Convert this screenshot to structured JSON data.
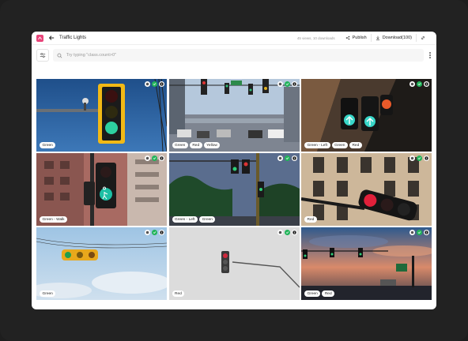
{
  "header": {
    "title": "Traffic Lights",
    "meta": "45 views, 10 downloads",
    "publish_label": "Publish",
    "download_label": "Download(100)"
  },
  "search": {
    "placeholder": "Try typing \"class.count>0\""
  },
  "tiles": [
    {
      "labels": [
        "Green"
      ]
    },
    {
      "labels": [
        "Green",
        "Red",
        "Yellow"
      ]
    },
    {
      "labels": [
        "Green - Left",
        "Green",
        "Red"
      ]
    },
    {
      "labels": [
        "Green - Walk"
      ]
    },
    {
      "labels": [
        "Green - Left",
        "Green"
      ]
    },
    {
      "labels": [
        "Red"
      ]
    },
    {
      "labels": [
        "Green"
      ]
    },
    {
      "labels": [
        "Red"
      ]
    },
    {
      "labels": [
        "Green",
        "Red"
      ]
    }
  ],
  "icons": {
    "logo": "app-logo-icon",
    "back": "arrow-left-icon",
    "publish": "share-icon",
    "download": "download-icon",
    "link": "link-icon",
    "filter": "sliders-icon",
    "search": "search-icon",
    "more": "more-vertical-icon"
  },
  "colors": {
    "brand": "#e8457a",
    "verified": "#22b45a"
  }
}
